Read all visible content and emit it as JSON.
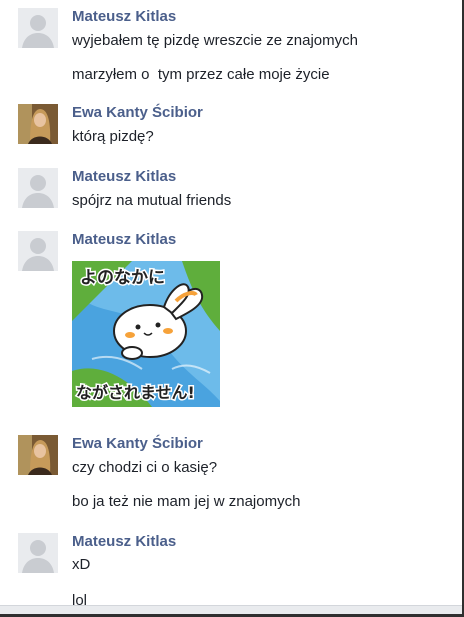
{
  "messages": [
    {
      "sender": "Mateusz Kitlas",
      "avatar": "default-silhouette-avatar",
      "lines": [
        "wyjebałem tę pizdę wreszcie ze znajomych",
        "marzyłem o  tym przez całe moje życie"
      ]
    },
    {
      "sender": "Ewa Kanty Ścibior",
      "avatar": "profile-photo-avatar",
      "lines": [
        "którą pizdę?"
      ]
    },
    {
      "sender": "Mateusz Kitlas",
      "avatar": "default-silhouette-avatar",
      "lines": [
        "spójrz na mutual friends"
      ]
    },
    {
      "sender": "Mateusz Kitlas",
      "avatar": "default-silhouette-avatar",
      "sticker": {
        "caption_top": "よのなかに",
        "caption_bottom": "ながされません!",
        "colors": {
          "water": "#4aa3df",
          "grass": "#5fae3c",
          "rabbit": "#ffffff",
          "ears": "#f6a23a"
        }
      }
    },
    {
      "sender": "Ewa Kanty Ścibior",
      "avatar": "profile-photo-avatar",
      "lines": [
        "czy chodzi ci o kasię?",
        "bo ja też nie mam jej w znajomych"
      ]
    },
    {
      "sender": "Mateusz Kitlas",
      "avatar": "default-silhouette-avatar",
      "lines": [
        "xD",
        "lol"
      ]
    }
  ],
  "colors": {
    "name": "#4b5f8b",
    "text": "#1d2129",
    "avatar_bg": "#e9ebee",
    "avatar_fg": "#c9ccd1"
  }
}
